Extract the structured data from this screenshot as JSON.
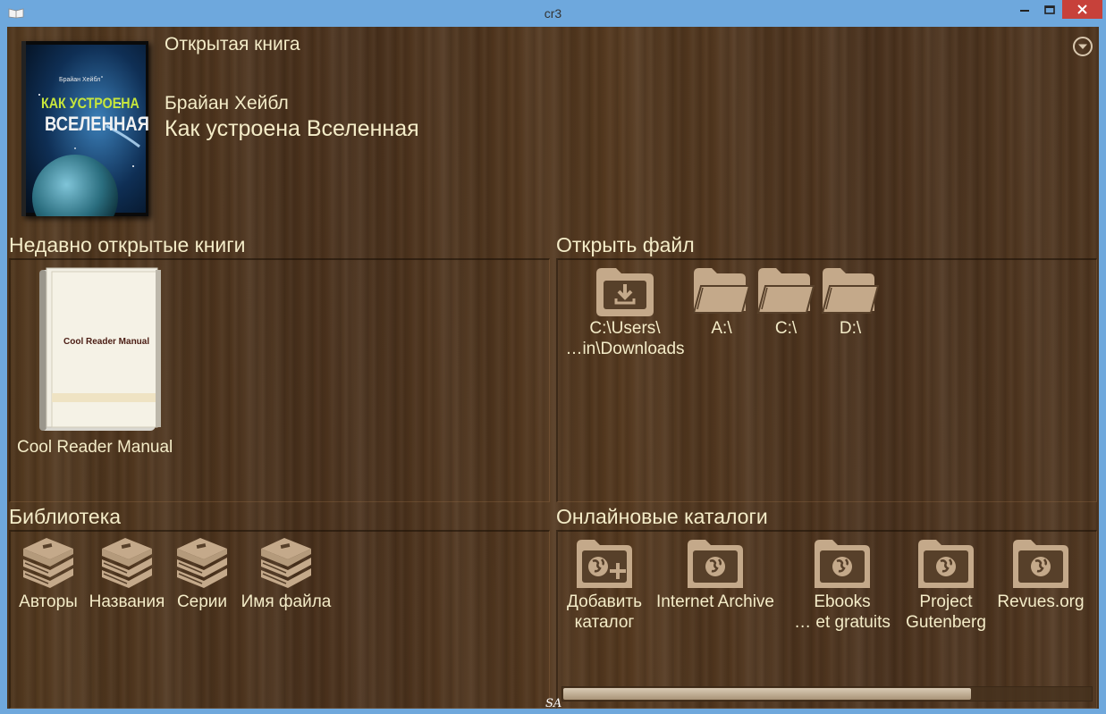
{
  "window": {
    "title": "cr3",
    "app_icon": "cool-reader-icon",
    "controls": [
      "minimize-icon",
      "maximize-icon",
      "close-icon"
    ]
  },
  "current_book": {
    "section_label": "Открытая книга",
    "author": "Брайан Хейбл",
    "title": "Как устроена Вселенная",
    "cover": {
      "author_small": "Брайан Хейбл",
      "title_line1": "КАК УСТРОЕНА",
      "title_line2": "ВСЕЛЕННАЯ"
    },
    "menu_icon": "chevron-down-circle-icon"
  },
  "recent": {
    "section_label": "Недавно открытые книги",
    "books": [
      {
        "cover_text": "Cool Reader Manual",
        "label": "Cool Reader Manual"
      }
    ]
  },
  "open_file": {
    "section_label": "Открыть файл",
    "items": [
      {
        "icon": "download-folder-icon",
        "line1": "C:\\Users\\",
        "line2": "…in\\Downloads"
      },
      {
        "icon": "folder-icon",
        "line1": "A:\\",
        "line2": ""
      },
      {
        "icon": "folder-icon",
        "line1": "C:\\",
        "line2": ""
      },
      {
        "icon": "folder-icon",
        "line1": "D:\\",
        "line2": ""
      }
    ]
  },
  "library": {
    "section_label": "Библиотека",
    "items": [
      {
        "icon": "books-icon",
        "label": "Авторы"
      },
      {
        "icon": "books-icon",
        "label": "Названия"
      },
      {
        "icon": "books-icon",
        "label": "Серии"
      },
      {
        "icon": "books-icon",
        "label": "Имя файла"
      }
    ]
  },
  "catalogs": {
    "section_label": "Онлайновые каталоги",
    "items": [
      {
        "icon": "add-catalog-icon",
        "line1": "Добавить",
        "line2": "каталог"
      },
      {
        "icon": "globe-folder-icon",
        "line1": "Internet Archive",
        "line2": ""
      },
      {
        "icon": "globe-folder-icon",
        "line1": "Ebooks",
        "line2": "… et gratuits"
      },
      {
        "icon": "globe-folder-icon",
        "line1": "Project",
        "line2": "Gutenberg"
      },
      {
        "icon": "globe-folder-icon",
        "line1": "Revues.org",
        "line2": ""
      }
    ],
    "scroll_position": 0.77
  },
  "footer": {
    "mark": "SA"
  },
  "colors": {
    "text": "#f4ecc8",
    "wood": "#4e3520",
    "icon": "#c4a98a",
    "titlebar": "#6ea8dd",
    "close": "#c7413a"
  }
}
